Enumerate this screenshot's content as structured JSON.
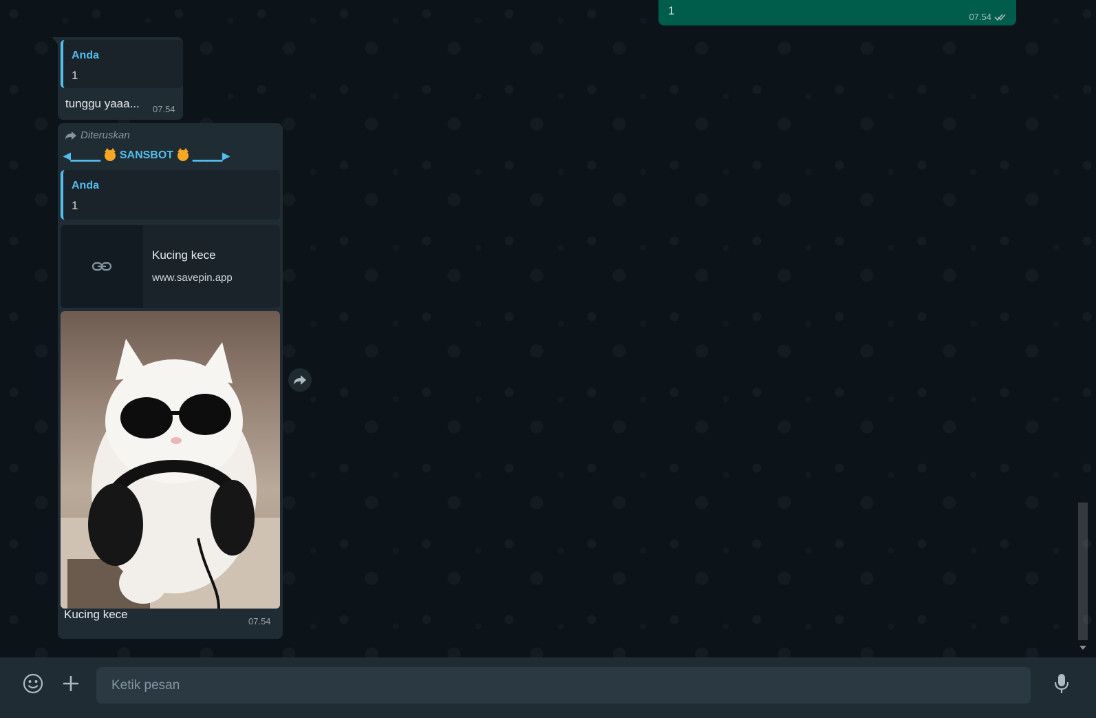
{
  "conversation": {
    "outgoing_top": {
      "text": "1",
      "time": "07.54",
      "status": "read-double-tick"
    },
    "reply_message": {
      "quote_author": "Anda",
      "quote_text": "1",
      "text": "tunggu yaaa...",
      "time": "07.54"
    },
    "forwarded_message": {
      "forwarded_label": "Diteruskan",
      "bot_name": "SANSBOT",
      "bot_left_arrow": "◀▁▁▁▁",
      "bot_right_arrow": "▁▁▁▁▶",
      "quote_author": "Anda",
      "quote_text": "1",
      "link_title": "Kucing kece",
      "link_url": "www.savepin.app",
      "caption": "Kucing kece",
      "time": "07.54"
    }
  },
  "composer": {
    "placeholder": "Ketik pesan",
    "value": ""
  },
  "colors": {
    "outgoing_bubble": "#005c4b",
    "incoming_bubble": "#202c33",
    "accent": "#53bdeb",
    "background": "#0b141a"
  },
  "icons": [
    "double-check-icon",
    "forward-icon",
    "link-icon",
    "share-icon",
    "emoji-icon",
    "plus-icon",
    "mic-icon"
  ]
}
